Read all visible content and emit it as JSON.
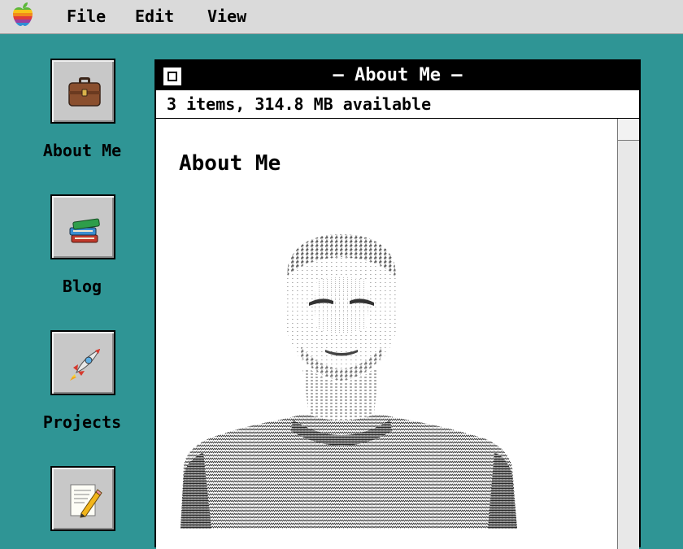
{
  "menubar": {
    "items": [
      "File",
      "Edit",
      "View"
    ]
  },
  "desktop": {
    "icons": [
      {
        "label": "About Me",
        "icon": "briefcase-icon"
      },
      {
        "label": "Blog",
        "icon": "books-icon"
      },
      {
        "label": "Projects",
        "icon": "rocket-icon"
      },
      {
        "label": "",
        "icon": "notepad-pencil-icon"
      }
    ]
  },
  "window": {
    "title": "— About Me —",
    "info": "3 items, 314.8 MB available",
    "heading": "About Me"
  },
  "colors": {
    "desktop": "#2f9595",
    "menubar": "#dadada",
    "titlebar": "#000000"
  }
}
